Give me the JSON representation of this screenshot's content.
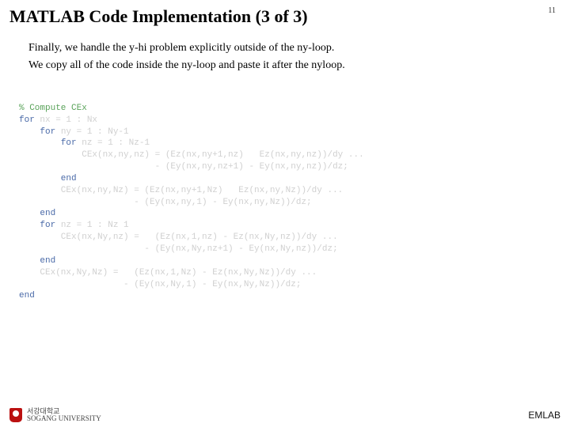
{
  "page_number": "11",
  "title": "MATLAB Code Implementation (3 of 3)",
  "paragraphs": [
    "Finally, we handle the y‐hi problem explicitly outside of the ny‐loop.",
    "We copy all of the code inside the ny‐loop and paste it after the nyloop."
  ],
  "code": {
    "comment": "% Compute CEx",
    "lines": [
      {
        "kw": "for",
        "rest": " nx = 1 : Nx"
      },
      {
        "kw": "    for",
        "rest": " ny = 1 : Ny-1"
      },
      {
        "kw": "        for",
        "rest": " nz = 1 : Nz-1"
      },
      {
        "kw": "",
        "rest": "            CEx(nx,ny,nz) = (Ez(nx,ny+1,nz)   Ez(nx,ny,nz))/dy ..."
      },
      {
        "kw": "",
        "rest": "                          - (Ey(nx,ny,nz+1) - Ey(nx,ny,nz))/dz;"
      },
      {
        "kw": "        end",
        "rest": ""
      },
      {
        "kw": "",
        "rest": "        CEx(nx,ny,Nz) = (Ez(nx,ny+1,Nz)   Ez(nx,ny,Nz))/dy ..."
      },
      {
        "kw": "",
        "rest": "                      - (Ey(nx,ny,1) - Ey(nx,ny,Nz))/dz;"
      },
      {
        "kw": "    end",
        "rest": ""
      },
      {
        "kw": "    for",
        "rest": " nz = 1 : Nz 1"
      },
      {
        "kw": "",
        "rest": "        CEx(nx,Ny,nz) =   (Ez(nx,1,nz) - Ez(nx,Ny,nz))/dy ..."
      },
      {
        "kw": "",
        "rest": "                        - (Ey(nx,Ny,nz+1) - Ey(nx,Ny,nz))/dz;"
      },
      {
        "kw": "    end",
        "rest": ""
      },
      {
        "kw": "",
        "rest": "    CEx(nx,Ny,Nz) =   (Ez(nx,1,Nz) - Ez(nx,Ny,Nz))/dy ..."
      },
      {
        "kw": "",
        "rest": "                    - (Ey(nx,Ny,1) - Ey(nx,Ny,Nz))/dz;"
      },
      {
        "kw": "end",
        "rest": ""
      }
    ]
  },
  "footer": {
    "university_kr": "서강대학교",
    "university_en": "SOGANG UNIVERSITY",
    "lab": "EMLAB"
  }
}
